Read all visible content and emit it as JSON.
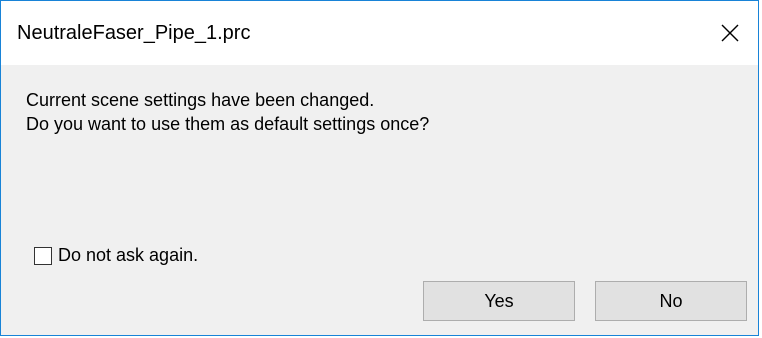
{
  "window": {
    "title": "NeutraleFaser_Pipe_1.prc",
    "close_icon": "close-icon"
  },
  "message": {
    "line1": "Current scene settings have been changed.",
    "line2": "Do you want to use them as default settings once?"
  },
  "checkbox": {
    "label": "Do not ask again.",
    "checked": false
  },
  "buttons": {
    "yes_label": "Yes",
    "no_label": "No"
  },
  "colors": {
    "border": "#1883d7",
    "dialog_bg": "#f0f0f0",
    "titlebar_bg": "#ffffff",
    "button_bg": "#e1e1e1",
    "button_border": "#adadad"
  }
}
